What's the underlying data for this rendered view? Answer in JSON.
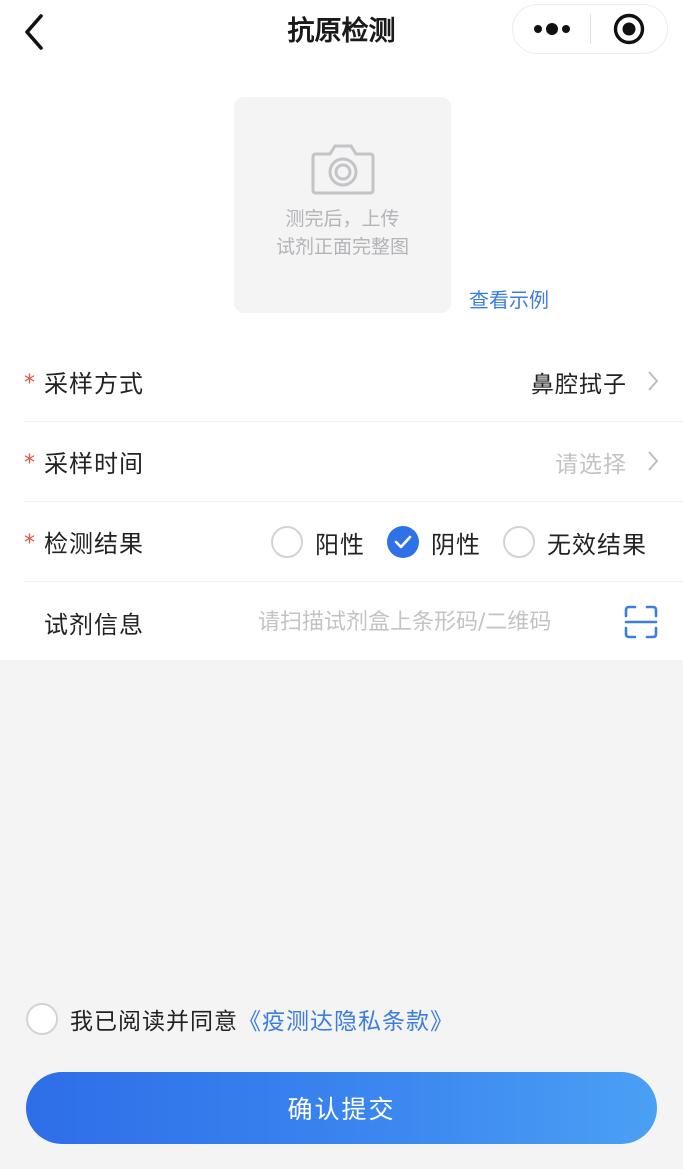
{
  "nav": {
    "title": "抗原检测",
    "back_icon": "chevron-left-icon",
    "more_icon": "more-dots-icon",
    "close_icon": "target-circle-icon"
  },
  "upload": {
    "hint": "测完后，上传\n试剂正面完整图",
    "example_link": "查看示例",
    "icon": "camera-icon"
  },
  "form": {
    "sampling_method": {
      "label": "采样方式",
      "value": "鼻腔拭子"
    },
    "sampling_time": {
      "label": "采样时间",
      "placeholder": "请选择"
    },
    "result": {
      "label": "检测结果",
      "options": [
        "阳性",
        "阴性",
        "无效结果"
      ],
      "selected": "阴性"
    },
    "reagent": {
      "label": "试剂信息",
      "placeholder": "请扫描试剂盒上条形码/二维码",
      "icon": "scan-icon"
    }
  },
  "agreement": {
    "text": "我已阅读并同意",
    "link": "《疫测达隐私条款》",
    "checked": false
  },
  "submit": {
    "label": "确认提交"
  },
  "colors": {
    "accent": "#2f72e8",
    "link": "#3d7de0",
    "required": "#e0533c",
    "background": "#f4f4f5"
  }
}
